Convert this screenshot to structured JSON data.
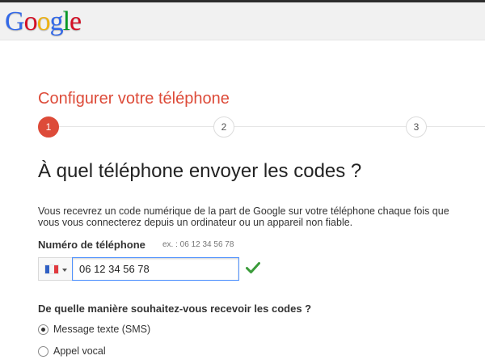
{
  "header": {
    "logo_letters": [
      {
        "char": "G",
        "color": "#3369e8"
      },
      {
        "char": "o",
        "color": "#d50f25"
      },
      {
        "char": "o",
        "color": "#eeb211"
      },
      {
        "char": "g",
        "color": "#3369e8"
      },
      {
        "char": "l",
        "color": "#009925"
      },
      {
        "char": "e",
        "color": "#d50f25"
      }
    ]
  },
  "setup": {
    "title": "Configurer votre téléphone",
    "steps": [
      "1",
      "2",
      "3"
    ],
    "active_step": 1,
    "heading": "À quel téléphone envoyer les codes ?",
    "description": "Vous recevrez un code numérique de la part de Google sur votre téléphone chaque fois que vous vous connecterez depuis un ordinateur ou un appareil non fiable."
  },
  "phone": {
    "label": "Numéro de téléphone",
    "example": "ex. : 06 12 34 56 78",
    "country_flag": "france-flag-icon",
    "value": "06 12 34 56 78",
    "valid_icon": "checkmark-icon",
    "valid_color": "#3a9b3a"
  },
  "delivery": {
    "label": "De quelle manière souhaitez-vous recevoir les codes ?",
    "options": [
      {
        "label": "Message texte (SMS)",
        "selected": true
      },
      {
        "label": "Appel vocal",
        "selected": false
      }
    ]
  },
  "colors": {
    "accent": "#dd4b39",
    "focus_border": "#4d90fe"
  }
}
